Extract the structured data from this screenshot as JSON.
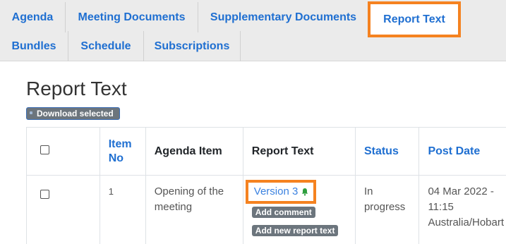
{
  "tabs": [
    {
      "label": "Agenda"
    },
    {
      "label": "Meeting Documents"
    },
    {
      "label": "Supplementary Documents"
    },
    {
      "label": "Report Text",
      "active": true
    },
    {
      "label": "Bundles"
    },
    {
      "label": "Schedule"
    },
    {
      "label": "Subscriptions"
    }
  ],
  "page": {
    "title": "Report Text",
    "download_label": "Download selected"
  },
  "table": {
    "headers": {
      "item_no": "Item No",
      "agenda_item": "Agenda Item",
      "report_text": "Report Text",
      "status": "Status",
      "post_date": "Post Date"
    },
    "rows": [
      {
        "item_no": "1",
        "agenda_item": "Opening of the meeting",
        "version": "Version 3",
        "add_comment": "Add comment",
        "add_report": "Add new report text",
        "status": "In progress",
        "post_date": "04 Mar 2022 - 11:15 Australia/Hobart"
      }
    ]
  },
  "colors": {
    "link": "#1f6fd1",
    "highlight": "#f58220",
    "badge": "#6c757d",
    "bell": "#2e9e3e"
  },
  "icons": [
    "bell-icon",
    "checkbox"
  ]
}
